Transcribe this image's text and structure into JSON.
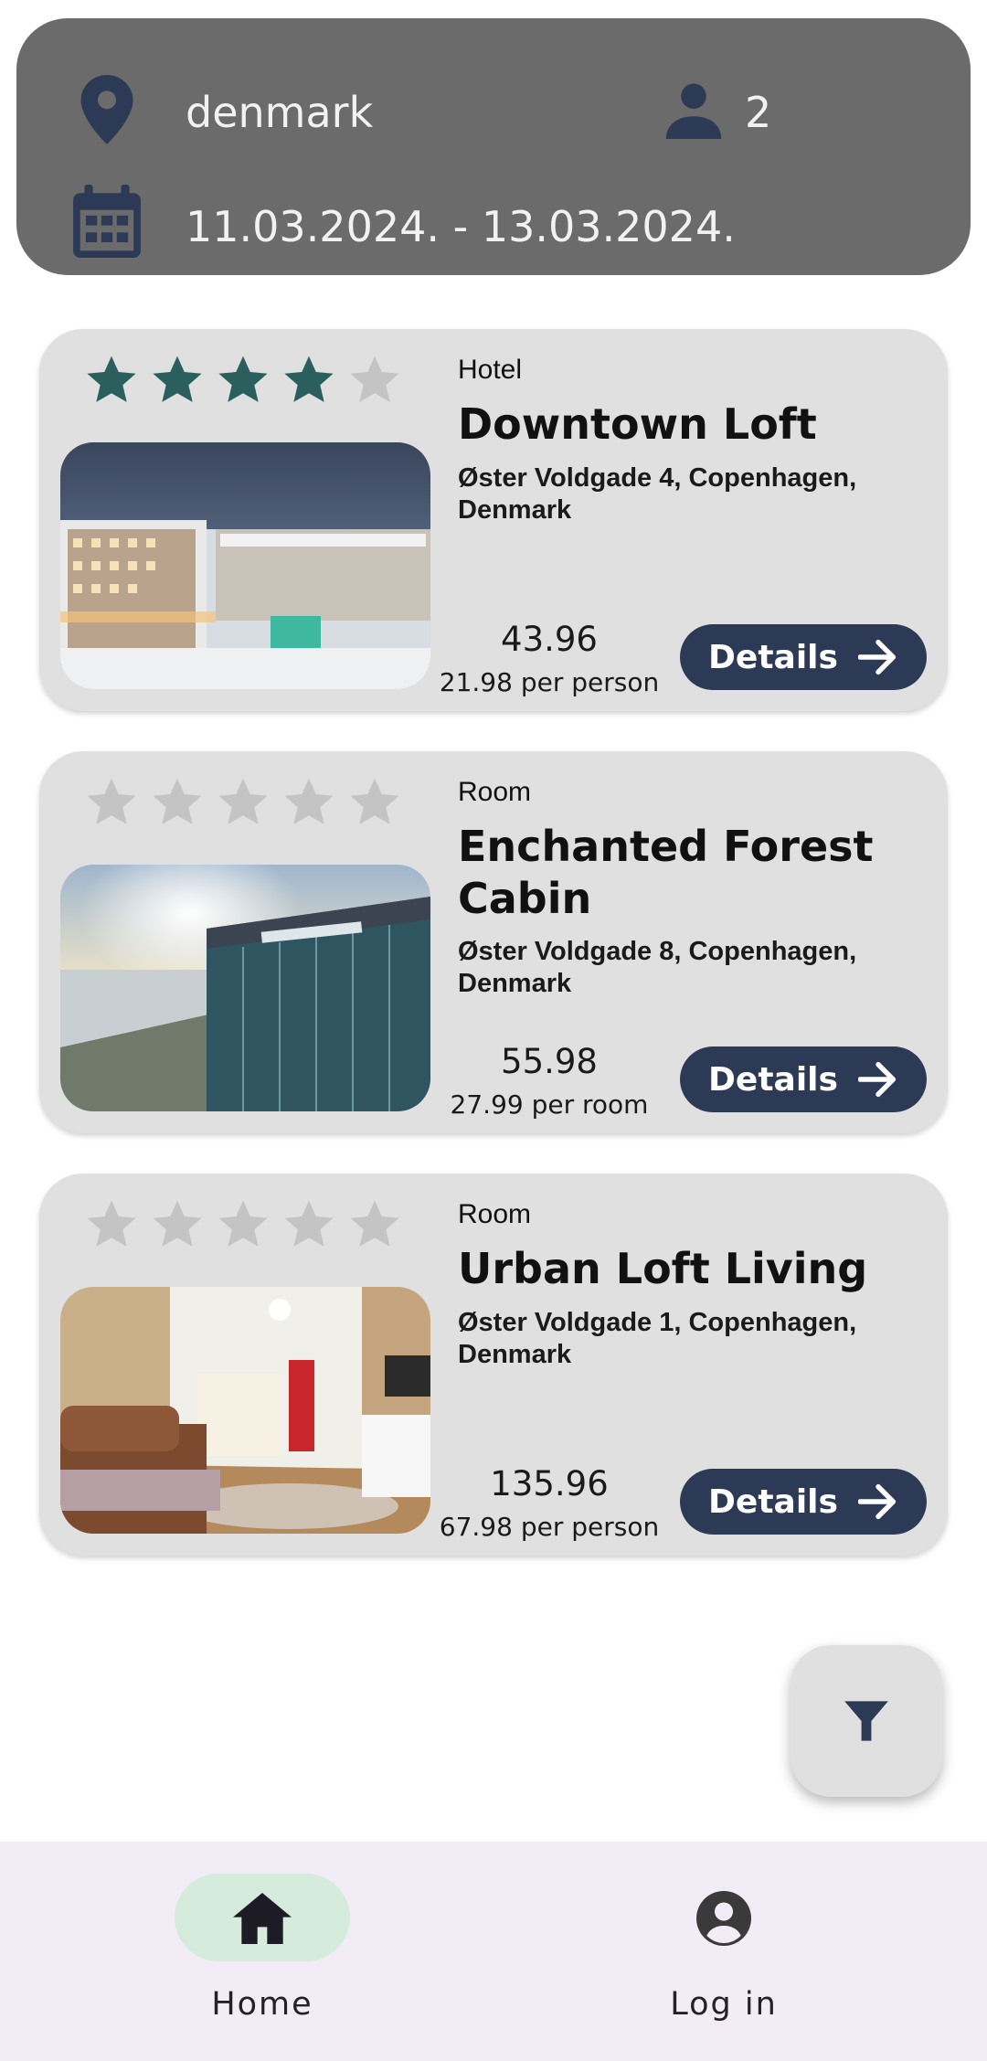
{
  "search": {
    "destination": "denmark",
    "guests": "2",
    "dates": "11.03.2024. - 13.03.2024."
  },
  "listings": [
    {
      "type": "Hotel",
      "name": "Downtown Loft",
      "address": "Øster Voldgade 4, Copenhagen, Denmark",
      "price": "43.96",
      "per": "21.98 per person",
      "rating": 4,
      "rating_max": 5,
      "details_label": "Details",
      "image": "hotel-snow-resort-photo"
    },
    {
      "type": "Room",
      "name": "Enchanted Forest Cabin",
      "address": "Øster Voldgade 8, Copenhagen, Denmark",
      "price": "55.98",
      "per": "27.99 per room",
      "rating": 0,
      "rating_max": 5,
      "details_label": "Details",
      "image": "glass-hotel-waterfront-photo"
    },
    {
      "type": "Room",
      "name": "Urban Loft Living",
      "address": "Øster Voldgade 1, Copenhagen, Denmark",
      "price": "135.96",
      "per": "67.98 per person",
      "rating": 0,
      "rating_max": 5,
      "details_label": "Details",
      "image": "apartment-interior-photo"
    }
  ],
  "fab": {
    "icon": "filter-icon"
  },
  "nav": [
    {
      "label": "Home",
      "icon": "home-icon",
      "active": true
    },
    {
      "label": "Log in",
      "icon": "account-circle-icon",
      "active": false
    }
  ],
  "colors": {
    "header_bg": "#6b6b6b",
    "accent": "#2d3a55",
    "star_filled": "#2b5f5e",
    "star_empty": "#c4c4c4",
    "card_bg": "#e0e0e0",
    "nav_bg": "#f1ecf5",
    "nav_active": "#d5ecdd"
  }
}
